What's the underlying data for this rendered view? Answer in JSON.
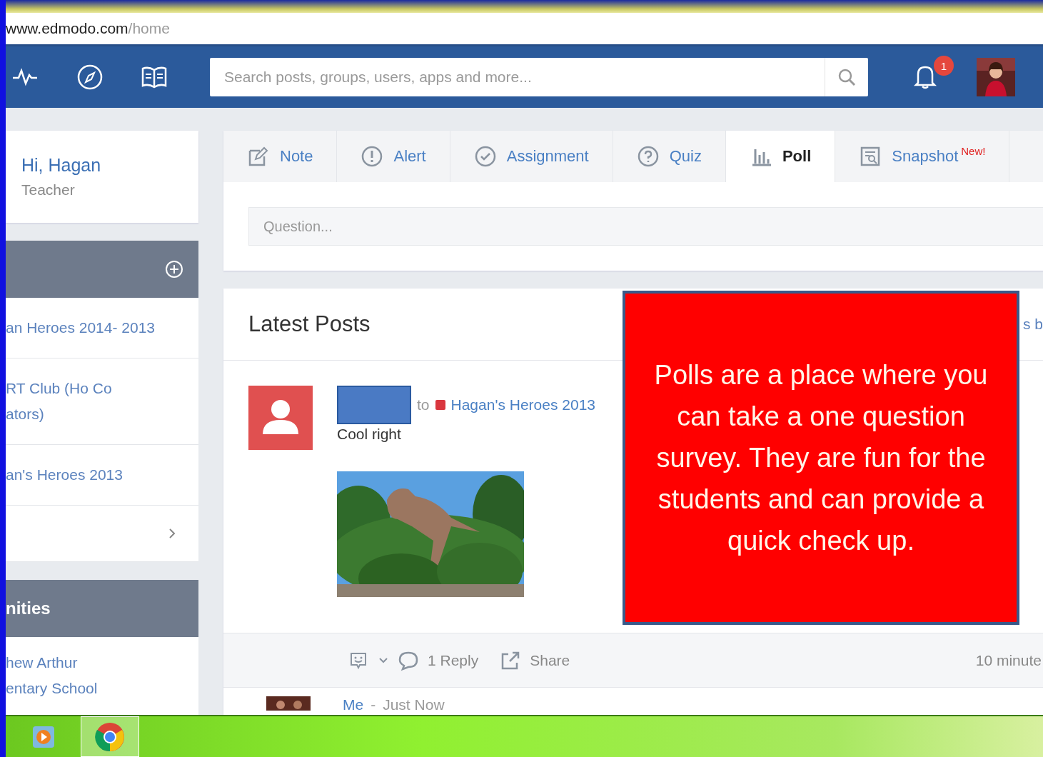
{
  "browser": {
    "url_host": "www.edmodo.com",
    "url_path": "/home"
  },
  "nav": {
    "search_placeholder": "Search posts, groups, users, apps and more...",
    "notification_count": "1"
  },
  "profile": {
    "greeting": "Hi, Hagan",
    "role": "Teacher"
  },
  "groups": [
    {
      "lines": [
        "an Heroes 2014- 2013"
      ]
    },
    {
      "lines": [
        "RT Club (Ho Co",
        "ators)"
      ]
    },
    {
      "lines": [
        "an's Heroes 2013"
      ]
    }
  ],
  "communities": {
    "title": "nities",
    "items": [
      {
        "lines": [
          "hew Arthur",
          "entary School"
        ]
      }
    ]
  },
  "composer": {
    "tabs": [
      {
        "label": "Note",
        "selected": false
      },
      {
        "label": "Alert",
        "selected": false
      },
      {
        "label": "Assignment",
        "selected": false
      },
      {
        "label": "Quiz",
        "selected": false
      },
      {
        "label": "Poll",
        "selected": true
      },
      {
        "label": "Snapshot",
        "badge": "New!",
        "selected": false
      }
    ],
    "placeholder": "Question..."
  },
  "feed": {
    "title": "Latest Posts",
    "header_cut": "s b",
    "post": {
      "prefix": "to",
      "group": "Hagan's Heroes 2013",
      "text": "Cool right",
      "reply": "1 Reply",
      "share": "Share",
      "time": "10 minute"
    },
    "next": {
      "author": "Me",
      "separator": "-",
      "time": "Just Now"
    }
  },
  "callout": {
    "text": "Polls are a place where you can take a one question survey. They are fun for the students and can provide a quick check up."
  },
  "taskbar": [
    {
      "selected": false
    },
    {
      "selected": true
    }
  ]
}
